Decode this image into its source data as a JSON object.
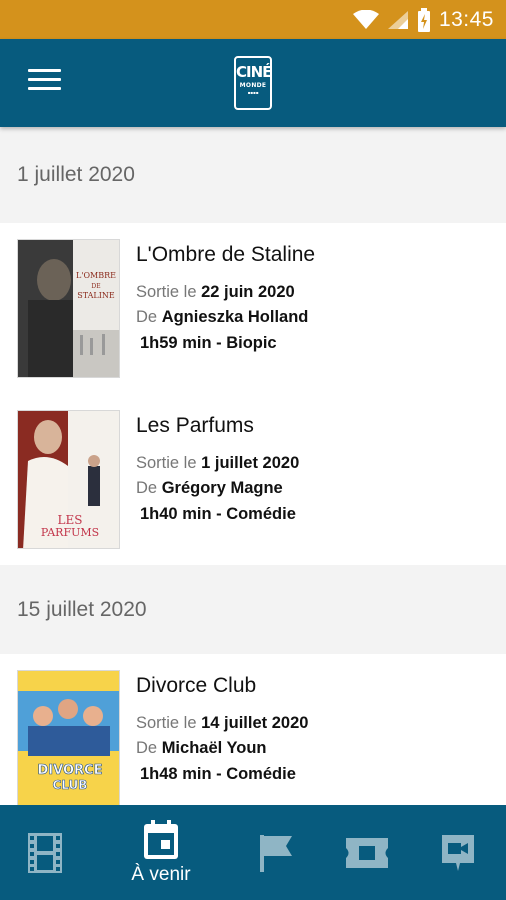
{
  "status_bar": {
    "time": "13:45"
  },
  "app_bar": {
    "logo_top": "CINÉ",
    "logo_bottom": "MONDE"
  },
  "sections": [
    {
      "date": "1 juillet 2020",
      "films": [
        {
          "title": "L'Ombre de Staline",
          "release_prefix": "Sortie le",
          "release_date": "22 juin 2020",
          "director_prefix": "De",
          "director": "Agnieszka Holland",
          "info": "1h59 min - Biopic"
        },
        {
          "title": "Les Parfums",
          "release_prefix": "Sortie le",
          "release_date": "1 juillet 2020",
          "director_prefix": "De",
          "director": "Grégory Magne",
          "info": "1h40 min - Comédie"
        }
      ]
    },
    {
      "date": "15 juillet 2020",
      "films": [
        {
          "title": "Divorce Club",
          "release_prefix": "Sortie le",
          "release_date": "14 juillet 2020",
          "director_prefix": "De",
          "director": "Michaël Youn",
          "info": "1h48 min - Comédie"
        }
      ]
    }
  ],
  "posters": {
    "staline": {
      "line1": "L'OMBRE",
      "line2": "DE",
      "line3": "STALINE"
    },
    "parfums": {
      "line1": "LES",
      "line2": "PARFUMS"
    },
    "divorce": {
      "line1": "DIVORCE",
      "line2": "CLUB"
    }
  },
  "bottom_nav": {
    "items": [
      {
        "icon": "film-icon",
        "label": ""
      },
      {
        "icon": "calendar-icon",
        "label": "À venir"
      },
      {
        "icon": "flag-icon",
        "label": ""
      },
      {
        "icon": "ticket-icon",
        "label": ""
      },
      {
        "icon": "video-icon",
        "label": ""
      }
    ]
  },
  "colors": {
    "status_bar": "#d4921c",
    "primary": "#075b7e",
    "background": "#f3f3f3"
  }
}
